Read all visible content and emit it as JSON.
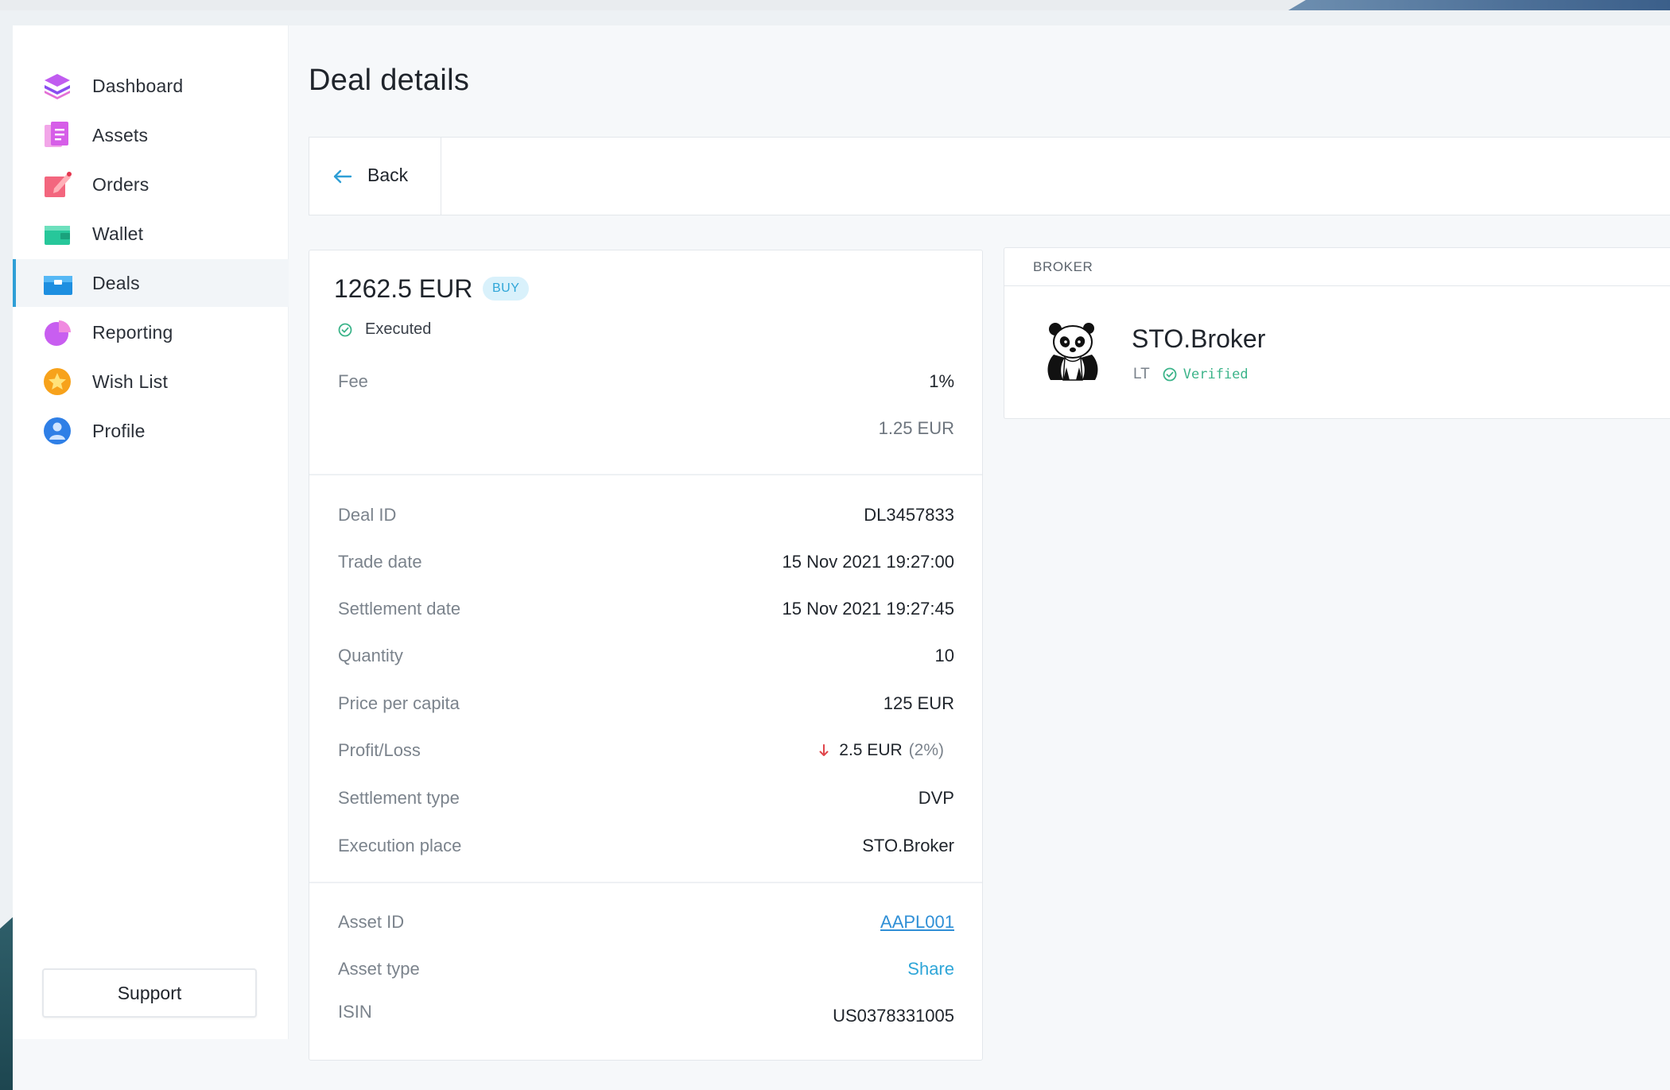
{
  "sidebar": {
    "items": [
      {
        "label": "Dashboard",
        "icon": "layers-icon"
      },
      {
        "label": "Assets",
        "icon": "document-icon"
      },
      {
        "label": "Orders",
        "icon": "edit-note-icon"
      },
      {
        "label": "Wallet",
        "icon": "wallet-icon"
      },
      {
        "label": "Deals",
        "icon": "briefcase-icon",
        "active": true
      },
      {
        "label": "Reporting",
        "icon": "pie-chart-icon"
      },
      {
        "label": "Wish List",
        "icon": "star-icon"
      },
      {
        "label": "Profile",
        "icon": "user-icon"
      }
    ],
    "support_label": "Support"
  },
  "page": {
    "title": "Deal details",
    "back_label": "Back"
  },
  "deal": {
    "amount": "1262.5 EUR",
    "side_badge": "BUY",
    "status": "Executed",
    "fee": {
      "label": "Fee",
      "percent": "1%",
      "amount": "1.25 EUR"
    },
    "details": {
      "deal_id": {
        "label": "Deal ID",
        "value": "DL3457833"
      },
      "trade_date": {
        "label": "Trade date",
        "value": "15 Nov 2021 19:27:00"
      },
      "settlement_date": {
        "label": "Settlement date",
        "value": "15 Nov 2021 19:27:45"
      },
      "quantity": {
        "label": "Quantity",
        "value": "10"
      },
      "price_per_capita": {
        "label": "Price per capita",
        "value": "125 EUR"
      },
      "profit_loss": {
        "label": "Profit/Loss",
        "value": "2.5 EUR",
        "percent": "(2%)",
        "direction": "down"
      },
      "settlement_type": {
        "label": "Settlement type",
        "value": "DVP"
      },
      "execution_place": {
        "label": "Execution place",
        "value": "STO.Broker"
      }
    },
    "asset": {
      "asset_id": {
        "label": "Asset ID",
        "value": "AAPL001"
      },
      "asset_type": {
        "label": "Asset type",
        "value": "Share"
      },
      "isin": {
        "label": "ISIN",
        "value": "US0378331005"
      }
    }
  },
  "broker": {
    "header": "BROKER",
    "name": "STO.Broker",
    "country": "LT",
    "verified_label": "Verified",
    "logo": "panda-logo"
  },
  "colors": {
    "accent": "#2f9fd6",
    "verified": "#3cb48a",
    "loss": "#e0454b",
    "badge_bg": "#d9f1fb"
  }
}
